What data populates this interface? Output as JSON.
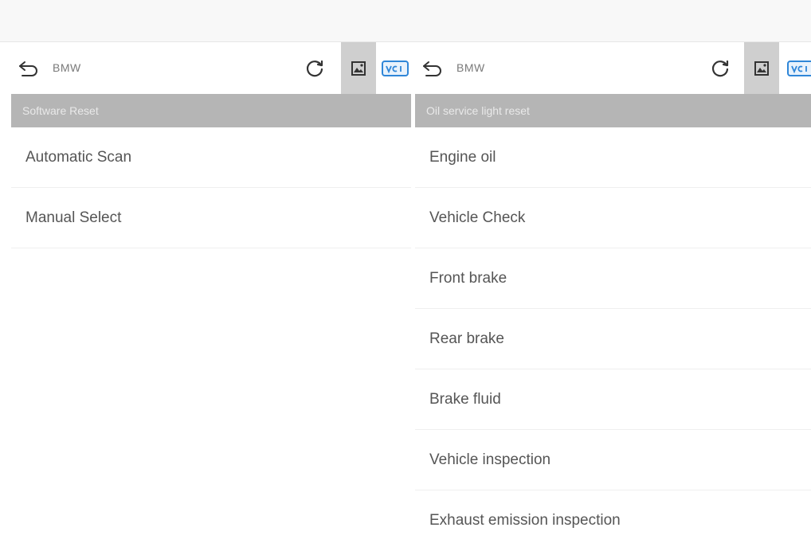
{
  "left_panel": {
    "title": "BMW",
    "section_header": "Software Reset",
    "items": [
      "Automatic Scan",
      "Manual Select"
    ]
  },
  "right_panel": {
    "title": "BMW",
    "section_header": "Oil service light reset",
    "items": [
      "Engine oil",
      "Vehicle Check",
      "Front brake",
      "Rear brake",
      "Brake fluid",
      "Vehicle inspection",
      "Exhaust emission inspection"
    ]
  },
  "icons": {
    "back": "back-arrow-icon",
    "refresh": "refresh-icon",
    "image": "image-icon",
    "vci": "vci-icon"
  },
  "colors": {
    "header_bg": "#b5b5b5",
    "image_btn_bg": "#cfcfcf",
    "vci_blue": "#2f86d8",
    "text": "#555555"
  }
}
